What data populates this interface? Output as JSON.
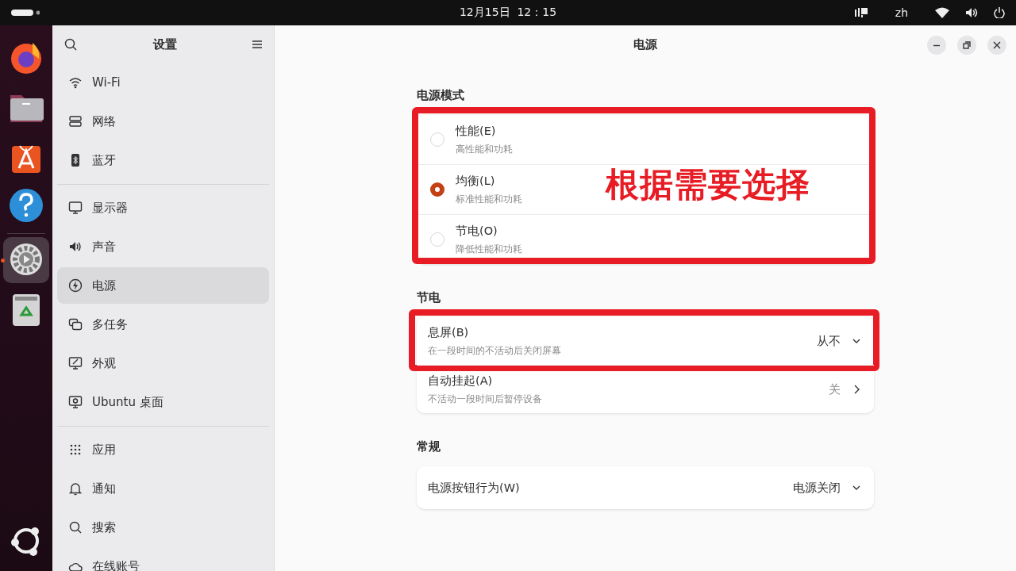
{
  "top_bar": {
    "clock": "12月15日  12：15",
    "input_method": "zh"
  },
  "dock": {
    "apps": [
      {
        "kind": "browser",
        "running": false
      },
      {
        "kind": "files",
        "running": false
      },
      {
        "kind": "store",
        "running": false
      },
      {
        "kind": "help",
        "running": false
      },
      {
        "kind": "settings",
        "running": true
      },
      {
        "kind": "trash",
        "running": false
      }
    ]
  },
  "sidebar": {
    "title": "设置",
    "groups": [
      [
        {
          "kind": "wifi",
          "label": "Wi-Fi",
          "selected": false
        },
        {
          "kind": "network",
          "label": "网络",
          "selected": false
        },
        {
          "kind": "bluetooth",
          "label": "蓝牙",
          "selected": false
        }
      ],
      [
        {
          "kind": "display",
          "label": "显示器",
          "selected": false
        },
        {
          "kind": "sound",
          "label": "声音",
          "selected": false
        },
        {
          "kind": "power",
          "label": "电源",
          "selected": true
        },
        {
          "kind": "multitask",
          "label": "多任务",
          "selected": false
        },
        {
          "kind": "appearance",
          "label": "外观",
          "selected": false
        },
        {
          "kind": "desktop",
          "label": "Ubuntu 桌面",
          "selected": false
        }
      ],
      [
        {
          "kind": "apps",
          "label": "应用",
          "selected": false
        },
        {
          "kind": "bell",
          "label": "通知",
          "selected": false
        },
        {
          "kind": "search",
          "label": "搜索",
          "selected": false
        },
        {
          "kind": "cloud",
          "label": "在线账号",
          "selected": false
        }
      ]
    ]
  },
  "window": {
    "title": "电源"
  },
  "sections": [
    {
      "heading": "电源模式",
      "highlighted": true,
      "callout": "根据需要选择",
      "rows": [
        {
          "kind": "radio",
          "label": "性能(E)",
          "description": "高性能和功耗",
          "selected": false
        },
        {
          "kind": "radio",
          "label": "均衡(L)",
          "description": "标准性能和功耗",
          "selected": true
        },
        {
          "kind": "radio",
          "label": "节电(O)",
          "description": "降低性能和功耗",
          "selected": false
        }
      ]
    },
    {
      "heading": "节电",
      "rows": [
        {
          "kind": "dropdown",
          "label": "息屏(B)",
          "description": "在一段时间的不活动后关闭屏幕",
          "value": "从不",
          "highlighted": true
        },
        {
          "kind": "link",
          "label": "自动挂起(A)",
          "description": "不活动一段时间后暂停设备",
          "value": "关"
        }
      ]
    },
    {
      "heading": "常规",
      "rows": [
        {
          "kind": "dropdown",
          "label": "电源按钮行为(W)",
          "value": "电源关闭"
        }
      ]
    }
  ]
}
